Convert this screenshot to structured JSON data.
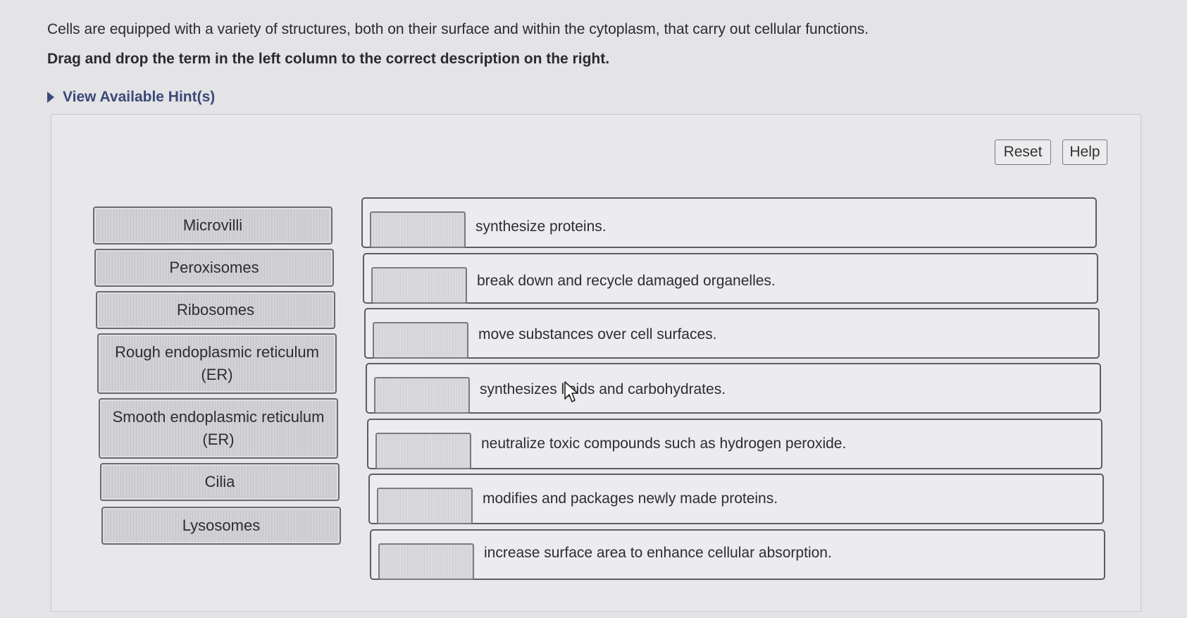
{
  "question": {
    "intro": "Cells are equipped with a variety of structures, both on their surface and within the cytoplasm, that carry out cellular functions.",
    "instruction": "Drag and drop the term in the left column to the correct description on the right.",
    "hint_label": "View Available Hint(s)"
  },
  "toolbar": {
    "reset_label": "Reset",
    "help_label": "Help"
  },
  "terms": [
    "Microvilli",
    "Peroxisomes",
    "Ribosomes",
    "Rough endoplasmic reticulum (ER)",
    "Smooth endoplasmic reticulum (ER)",
    "Cilia",
    "Lysosomes"
  ],
  "descriptions": [
    "synthesize proteins.",
    "break down and recycle damaged organelles.",
    "move substances over cell surfaces.",
    "synthesizes lipids and carbohydrates.",
    "neutralize toxic compounds such as hydrogen peroxide.",
    "modifies and packages newly made proteins.",
    "increase surface area to enhance cellular absorption."
  ],
  "icons": {
    "hint_toggle": "triangle-right-icon",
    "cursor": "mouse-pointer-icon"
  }
}
